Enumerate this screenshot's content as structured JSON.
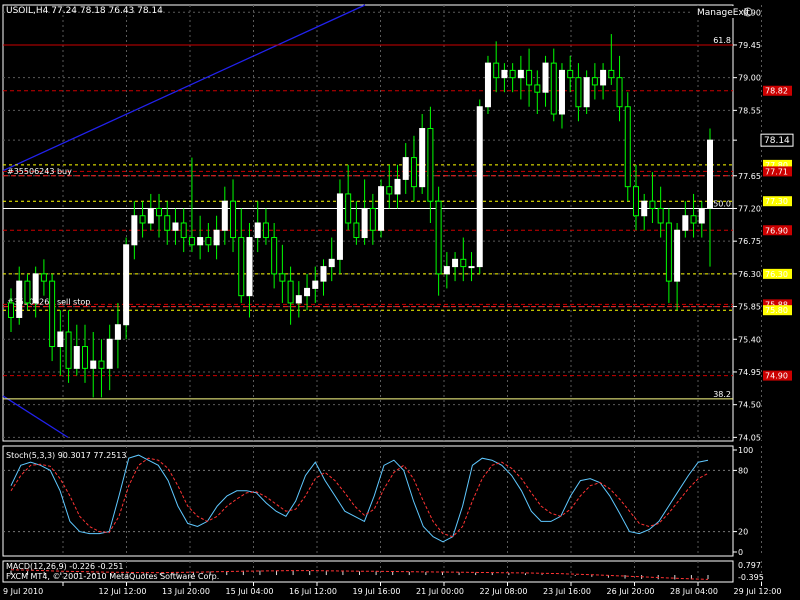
{
  "chart_data": [
    {
      "type": "candlestick",
      "title": "USOIL,H4",
      "ohlc_text": "77.24 78.18 76.43 78.14",
      "timeframe": "H4",
      "ylim": [
        74.0,
        80.0
      ],
      "price_ticks": [
        "79.90",
        "79.45",
        "79.00",
        "78.55",
        "78.14",
        "77.65",
        "77.20",
        "76.75",
        "76.30",
        "75.85",
        "75.40",
        "74.95",
        "74.50",
        "74.05"
      ],
      "x_labels": [
        "9 Jul 2010",
        "12 Jul 12:00",
        "13 Jul 20:00",
        "15 Jul 04:00",
        "16 Jul 12:00",
        "19 Jul 16:00",
        "21 Jul 00:00",
        "22 Jul 08:00",
        "23 Jul 16:00",
        "26 Jul 20:00",
        "28 Jul 04:00",
        "29 Jul 12:00"
      ],
      "current_price": "78.14",
      "manage_button": "ManageExit",
      "bull_color": "#ffffff",
      "bear_color": "#00ff00",
      "orders": [
        {
          "label": "#35506243 buy",
          "price": 77.65
        },
        {
          "label": "#35506264 sell stop",
          "price": 75.85
        }
      ],
      "fib_levels": [
        {
          "label": "61.8",
          "price": 79.45,
          "color": "#cc0000"
        },
        {
          "label": "50.0",
          "price": 77.2,
          "color": "#ffffff"
        },
        {
          "label": "38.2",
          "price": 74.58,
          "color": "#ffff88"
        }
      ],
      "price_tags": [
        {
          "text": "78.82",
          "price": 78.82,
          "bg": "#cc0000",
          "fg": "#000000"
        },
        {
          "text": "77.80",
          "price": 77.8,
          "bg": "#ffff00",
          "fg": "#000000"
        },
        {
          "text": "77.71",
          "price": 77.71,
          "bg": "#cc0000",
          "fg": "#000000"
        },
        {
          "text": "77.30",
          "price": 77.3,
          "bg": "#ffff00",
          "fg": "#000000"
        },
        {
          "text": "76.90",
          "price": 76.9,
          "bg": "#cc0000",
          "fg": "#000000"
        },
        {
          "text": "76.30",
          "price": 76.3,
          "bg": "#ffff00",
          "fg": "#000000"
        },
        {
          "text": "75.88",
          "price": 75.88,
          "bg": "#cc0000",
          "fg": "#000000"
        },
        {
          "text": "75.80",
          "price": 75.8,
          "bg": "#ffff00",
          "fg": "#000000"
        },
        {
          "text": "74.90",
          "price": 74.9,
          "bg": "#cc0000",
          "fg": "#000000"
        }
      ],
      "candles": [
        [
          75.9,
          76.1,
          75.5,
          75.7
        ],
        [
          75.7,
          76.4,
          75.6,
          76.2
        ],
        [
          76.2,
          76.3,
          75.8,
          75.9
        ],
        [
          75.9,
          76.4,
          75.7,
          76.3
        ],
        [
          76.3,
          76.5,
          76.0,
          76.2
        ],
        [
          76.2,
          76.3,
          75.1,
          75.3
        ],
        [
          75.3,
          75.8,
          74.9,
          75.5
        ],
        [
          75.5,
          75.8,
          74.8,
          75.0
        ],
        [
          75.0,
          75.6,
          74.9,
          75.3
        ],
        [
          75.3,
          75.6,
          74.8,
          75.0
        ],
        [
          75.0,
          75.5,
          74.6,
          75.1
        ],
        [
          75.1,
          75.4,
          74.6,
          75.0
        ],
        [
          75.0,
          75.6,
          74.7,
          75.4
        ],
        [
          75.4,
          75.9,
          75.0,
          75.6
        ],
        [
          75.6,
          76.8,
          75.4,
          76.7
        ],
        [
          76.7,
          77.3,
          76.5,
          77.1
        ],
        [
          77.1,
          77.3,
          76.8,
          77.0
        ],
        [
          77.0,
          77.4,
          76.9,
          77.2
        ],
        [
          77.2,
          77.4,
          76.8,
          77.1
        ],
        [
          77.1,
          77.3,
          76.7,
          76.9
        ],
        [
          76.9,
          77.2,
          76.7,
          77.0
        ],
        [
          77.0,
          77.2,
          76.6,
          76.8
        ],
        [
          76.8,
          77.9,
          76.6,
          76.7
        ],
        [
          76.7,
          77.1,
          76.5,
          76.8
        ],
        [
          76.8,
          77.0,
          76.6,
          76.7
        ],
        [
          76.7,
          77.1,
          76.5,
          76.9
        ],
        [
          76.9,
          77.5,
          76.7,
          77.3
        ],
        [
          77.3,
          77.6,
          76.6,
          76.8
        ],
        [
          76.8,
          77.2,
          75.9,
          76.0
        ],
        [
          76.0,
          77.0,
          75.7,
          76.8
        ],
        [
          76.8,
          77.3,
          76.6,
          77.0
        ],
        [
          77.0,
          77.2,
          76.7,
          76.8
        ],
        [
          76.8,
          77.0,
          76.1,
          76.3
        ],
        [
          76.3,
          76.7,
          75.9,
          76.2
        ],
        [
          76.2,
          76.4,
          75.6,
          75.9
        ],
        [
          75.9,
          76.2,
          75.7,
          76.0
        ],
        [
          76.0,
          76.3,
          75.8,
          76.1
        ],
        [
          76.1,
          76.4,
          75.9,
          76.2
        ],
        [
          76.2,
          76.5,
          76.0,
          76.4
        ],
        [
          76.4,
          76.8,
          76.2,
          76.5
        ],
        [
          76.5,
          77.6,
          76.3,
          77.4
        ],
        [
          77.4,
          77.8,
          76.9,
          77.0
        ],
        [
          77.0,
          77.3,
          76.7,
          76.8
        ],
        [
          76.8,
          77.6,
          76.7,
          77.2
        ],
        [
          77.2,
          77.4,
          76.7,
          76.9
        ],
        [
          76.9,
          77.6,
          76.8,
          77.5
        ],
        [
          77.5,
          77.8,
          77.2,
          77.4
        ],
        [
          77.4,
          77.8,
          77.2,
          77.6
        ],
        [
          77.6,
          78.1,
          77.4,
          77.9
        ],
        [
          77.9,
          78.2,
          77.3,
          77.5
        ],
        [
          77.5,
          78.5,
          77.4,
          78.3
        ],
        [
          78.3,
          78.6,
          77.0,
          77.3
        ],
        [
          77.3,
          77.5,
          76.0,
          76.3
        ],
        [
          76.3,
          76.6,
          76.1,
          76.4
        ],
        [
          76.4,
          76.6,
          76.2,
          76.5
        ],
        [
          76.5,
          76.8,
          76.2,
          76.4
        ],
        [
          76.4,
          76.6,
          76.2,
          76.4
        ],
        [
          76.4,
          78.7,
          76.3,
          78.6
        ],
        [
          78.6,
          79.3,
          78.5,
          79.2
        ],
        [
          79.2,
          79.5,
          78.8,
          79.0
        ],
        [
          79.0,
          79.2,
          78.8,
          79.1
        ],
        [
          79.1,
          79.2,
          78.8,
          79.0
        ],
        [
          79.0,
          79.3,
          78.7,
          79.1
        ],
        [
          79.1,
          79.4,
          78.6,
          78.9
        ],
        [
          78.9,
          79.1,
          78.5,
          78.8
        ],
        [
          78.8,
          79.3,
          78.6,
          79.2
        ],
        [
          79.2,
          79.4,
          78.4,
          78.5
        ],
        [
          78.5,
          79.2,
          78.3,
          79.1
        ],
        [
          79.1,
          79.3,
          78.8,
          79.0
        ],
        [
          79.0,
          79.2,
          78.4,
          78.6
        ],
        [
          78.6,
          79.1,
          78.5,
          79.0
        ],
        [
          79.0,
          79.2,
          78.7,
          78.9
        ],
        [
          78.9,
          79.2,
          78.7,
          79.1
        ],
        [
          79.1,
          79.6,
          78.9,
          79.0
        ],
        [
          79.0,
          79.3,
          78.4,
          78.6
        ],
        [
          78.6,
          78.8,
          77.3,
          77.5
        ],
        [
          77.5,
          77.8,
          76.9,
          77.1
        ],
        [
          77.1,
          77.4,
          76.9,
          77.3
        ],
        [
          77.3,
          77.7,
          77.0,
          77.2
        ],
        [
          77.2,
          77.5,
          76.8,
          77.0
        ],
        [
          77.0,
          77.2,
          75.9,
          76.2
        ],
        [
          76.2,
          77.0,
          75.8,
          76.9
        ],
        [
          76.9,
          77.3,
          76.8,
          77.1
        ],
        [
          77.1,
          77.4,
          76.8,
          77.0
        ],
        [
          77.0,
          77.3,
          76.8,
          77.2
        ],
        [
          77.2,
          78.3,
          76.4,
          78.14
        ]
      ]
    },
    {
      "type": "line",
      "title": "Stoch(5,3,3) 90.3017 77.2513",
      "ylim": [
        0,
        100
      ],
      "y_ticks": [
        "100",
        "80",
        "20",
        "0"
      ],
      "series": [
        {
          "name": "Main",
          "color": "#5fc8ff",
          "values": [
            65,
            85,
            88,
            85,
            80,
            60,
            30,
            20,
            18,
            18,
            20,
            55,
            92,
            95,
            90,
            85,
            70,
            45,
            28,
            25,
            30,
            45,
            55,
            60,
            60,
            58,
            48,
            40,
            35,
            50,
            75,
            88,
            70,
            55,
            40,
            35,
            30,
            55,
            85,
            90,
            80,
            50,
            25,
            15,
            10,
            15,
            45,
            85,
            92,
            90,
            85,
            75,
            60,
            40,
            30,
            30,
            35,
            55,
            70,
            72,
            68,
            55,
            38,
            20,
            18,
            22,
            30,
            45,
            60,
            75,
            88,
            90
          ]
        },
        {
          "name": "Signal",
          "color": "#ff3333",
          "values": [
            60,
            75,
            85,
            86,
            84,
            72,
            55,
            35,
            25,
            20,
            19,
            35,
            65,
            85,
            92,
            90,
            82,
            65,
            45,
            35,
            30,
            35,
            45,
            52,
            58,
            59,
            54,
            47,
            40,
            42,
            55,
            72,
            78,
            70,
            58,
            45,
            36,
            42,
            62,
            78,
            85,
            72,
            50,
            30,
            18,
            15,
            25,
            50,
            72,
            85,
            88,
            82,
            72,
            58,
            45,
            38,
            35,
            42,
            55,
            65,
            68,
            62,
            52,
            40,
            28,
            25,
            28,
            38,
            50,
            62,
            72,
            77
          ]
        }
      ]
    },
    {
      "type": "bar",
      "title": "MACD(12,26,9) -0.226 -0.251",
      "ylim": [
        -0.395,
        0.797
      ],
      "y_ticks": [
        "0.797",
        "-0.395"
      ],
      "series": [
        {
          "name": "Signal",
          "color": "#ff3333",
          "values": [
            0.3,
            0.28,
            0.25,
            0.22,
            0.2,
            0.18,
            0.16,
            0.15,
            0.14,
            0.14,
            0.15,
            0.16,
            0.18,
            0.2,
            0.22,
            0.23,
            0.24,
            0.25,
            0.25,
            0.24,
            0.23,
            0.22,
            0.21,
            0.2,
            0.19,
            0.18,
            0.17,
            0.16,
            0.15,
            0.14,
            0.13,
            0.12,
            0.1,
            0.08,
            0.05,
            0.02,
            -0.02,
            -0.06,
            -0.1,
            -0.14,
            -0.18,
            -0.22,
            -0.25
          ]
        }
      ],
      "histogram": [
        0.25,
        0.22,
        0.18,
        0.15,
        0.12,
        0.1,
        0.08,
        0.09,
        0.1,
        0.12,
        0.15,
        0.18,
        0.2,
        0.22,
        0.24,
        0.25,
        0.25,
        0.24,
        0.23,
        0.22,
        0.22,
        0.21,
        0.2,
        0.19,
        0.18,
        0.17,
        0.16,
        0.15,
        0.14,
        0.13,
        0.12,
        0.1,
        0.05,
        0.0,
        -0.05,
        -0.1,
        -0.15,
        -0.2,
        -0.22,
        -0.24,
        -0.25,
        -0.23,
        -0.226
      ]
    }
  ],
  "footer": {
    "copyright": "FXCM MT4, © 2001-2010 MetaQuotes Software Corp."
  }
}
